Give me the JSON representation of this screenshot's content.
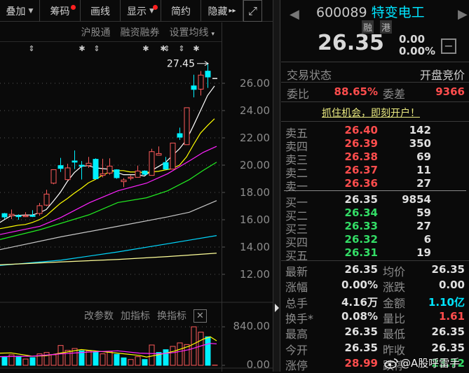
{
  "toolbar": {
    "items": [
      {
        "label": "叠加",
        "caret": true,
        "dot": false
      },
      {
        "label": "筹码",
        "caret": false,
        "dot": true
      },
      {
        "label": "画线",
        "caret": false,
        "dot": false
      },
      {
        "label": "显示",
        "caret": true,
        "dot": true
      },
      {
        "label": "简约",
        "caret": false,
        "dot": false
      },
      {
        "label": "隐藏",
        "caret": false,
        "dot": false,
        "suffix": "▸▸"
      }
    ],
    "expand_icon": "⤢"
  },
  "subheader": {
    "hgt": "沪股通",
    "margin": "融资融券",
    "ma_setting": "设置均线",
    "caret": "▾"
  },
  "markers": [
    "⇕",
    "✱",
    "⇕",
    "✱",
    "✱",
    "⇕",
    "⇕",
    "✱"
  ],
  "chart_data": {
    "type": "candlestick",
    "price_axis": {
      "ticks": [
        "26.00",
        "24.00",
        "22.00",
        "20.00",
        "18.00",
        "16.00",
        "14.00",
        "12.00"
      ],
      "range": [
        12,
        26
      ]
    },
    "max_label": "27.45",
    "candles": [
      [
        16.45,
        16.5,
        16.05,
        16.2
      ],
      [
        16.3,
        16.75,
        16.05,
        16.4
      ],
      [
        16.3,
        16.4,
        16.0,
        16.25
      ],
      [
        16.3,
        16.55,
        16.2,
        16.3
      ],
      [
        16.32,
        16.7,
        16.2,
        16.3
      ],
      [
        16.46,
        17.23,
        16.3,
        17.03
      ],
      [
        17.07,
        18.2,
        17.0,
        17.88
      ],
      [
        18.68,
        19.67,
        18.6,
        19.67
      ],
      [
        19.97,
        20.53,
        19.5,
        19.76
      ],
      [
        18.94,
        20.1,
        18.9,
        19.8
      ],
      [
        20.31,
        21.08,
        19.71,
        20.22
      ],
      [
        20.0,
        20.3,
        18.95,
        19.97
      ],
      [
        19.97,
        20.6,
        19.8,
        20.14
      ],
      [
        20.43,
        20.5,
        18.99,
        19.0
      ],
      [
        19.25,
        20.47,
        19.1,
        19.37
      ],
      [
        19.42,
        20.5,
        19.3,
        19.93
      ],
      [
        19.66,
        19.7,
        19.0,
        19.08
      ],
      [
        18.79,
        19.05,
        18.4,
        18.91
      ],
      [
        19.08,
        19.25,
        18.9,
        19.12
      ],
      [
        19.11,
        19.97,
        19.1,
        19.57
      ],
      [
        19.57,
        19.62,
        19.25,
        19.33
      ],
      [
        19.25,
        21.2,
        19.25,
        20.99
      ],
      [
        20.73,
        21.37,
        20.73,
        20.85
      ],
      [
        20.19,
        20.6,
        19.7,
        19.71
      ],
      [
        19.71,
        21.62,
        19.7,
        21.62
      ],
      [
        22.31,
        22.75,
        21.85,
        22.05
      ],
      [
        21.5,
        24.21,
        21.5,
        24.21
      ],
      [
        25.81,
        26.63,
        24.97,
        25.55
      ],
      [
        25.57,
        26.9,
        25.1,
        26.6
      ],
      [
        26.89,
        27.45,
        25.66,
        26.46
      ],
      [
        26.35,
        26.35,
        26.35,
        26.35
      ]
    ],
    "ma_lines": [
      {
        "name": "MA5",
        "color": "#ffffff",
        "points": [
          [
            0.4,
            15.8
          ],
          [
            1,
            16.0
          ],
          [
            2,
            16.3
          ],
          [
            3,
            16.32
          ],
          [
            4,
            16.35
          ],
          [
            5,
            16.35
          ],
          [
            6,
            16.5
          ],
          [
            7,
            16.75
          ],
          [
            8,
            17.35
          ],
          [
            9,
            18.0
          ],
          [
            10,
            18.8
          ],
          [
            11,
            19.45
          ],
          [
            12,
            19.9
          ],
          [
            13,
            19.97
          ],
          [
            14,
            19.8
          ],
          [
            15,
            19.75
          ],
          [
            16,
            19.7
          ],
          [
            17,
            19.5
          ],
          [
            18,
            19.3
          ],
          [
            19,
            19.3
          ],
          [
            20,
            19.3
          ],
          [
            21,
            19.2
          ],
          [
            22,
            19.6
          ],
          [
            23,
            19.9
          ],
          [
            24,
            20.2
          ],
          [
            25,
            20.7
          ],
          [
            26,
            21.2
          ],
          [
            27,
            21.85
          ],
          [
            28,
            22.9
          ],
          [
            29,
            24.0
          ],
          [
            30,
            25.1
          ],
          [
            31,
            25.8
          ]
        ]
      },
      {
        "name": "MA10",
        "color": "#ffff00",
        "points": [
          [
            0.4,
            15.35
          ],
          [
            1,
            15.4
          ],
          [
            2,
            15.5
          ],
          [
            3,
            15.6
          ],
          [
            4,
            15.65
          ],
          [
            5,
            15.8
          ],
          [
            6,
            16.0
          ],
          [
            7,
            16.3
          ],
          [
            8,
            16.75
          ],
          [
            9,
            17.2
          ],
          [
            10,
            17.55
          ],
          [
            11,
            17.95
          ],
          [
            12,
            18.3
          ],
          [
            13,
            18.7
          ],
          [
            14,
            18.95
          ],
          [
            15,
            19.25
          ],
          [
            16,
            19.5
          ],
          [
            17,
            19.6
          ],
          [
            18,
            19.6
          ],
          [
            19,
            19.5
          ],
          [
            20,
            19.5
          ],
          [
            21,
            19.45
          ],
          [
            22,
            19.5
          ],
          [
            23,
            19.55
          ],
          [
            24,
            19.65
          ],
          [
            25,
            19.75
          ],
          [
            26,
            20.0
          ],
          [
            27,
            20.6
          ],
          [
            28,
            21.5
          ],
          [
            29,
            22.35
          ],
          [
            30,
            22.9
          ],
          [
            31,
            23.4
          ]
        ]
      },
      {
        "name": "MA20",
        "color": "#ff22ff",
        "points": [
          [
            0.4,
            14.92
          ],
          [
            6.1,
            15.52
          ],
          [
            9.1,
            16.17
          ],
          [
            13.2,
            17.26
          ],
          [
            17.2,
            18.12
          ],
          [
            21.3,
            18.68
          ],
          [
            24.3,
            19.37
          ],
          [
            27.4,
            20.31
          ],
          [
            29.4,
            20.94
          ],
          [
            31.3,
            21.38
          ]
        ]
      },
      {
        "name": "MA30",
        "color": "#22ee22",
        "points": [
          [
            0.4,
            14.55
          ],
          [
            6.1,
            15.27
          ],
          [
            13.2,
            16.38
          ],
          [
            17.2,
            17.26
          ],
          [
            21.3,
            17.61
          ],
          [
            24.3,
            18.12
          ],
          [
            27.4,
            18.94
          ],
          [
            29.4,
            19.62
          ],
          [
            31.3,
            20.22
          ]
        ]
      },
      {
        "name": "MA60",
        "color": "#c8c8c8",
        "points": [
          [
            0.4,
            13.81
          ],
          [
            9.1,
            14.75
          ],
          [
            17.2,
            15.52
          ],
          [
            24.3,
            16.21
          ],
          [
            27.4,
            16.55
          ],
          [
            31.3,
            17.4
          ]
        ]
      },
      {
        "name": "MA120",
        "color": "#00d8ff",
        "points": [
          [
            0.4,
            12.65
          ],
          [
            9.1,
            13.04
          ],
          [
            17.2,
            13.64
          ],
          [
            24.3,
            14.24
          ],
          [
            31.3,
            14.84
          ]
        ]
      },
      {
        "name": "MA250",
        "color": "#ffff99",
        "points": [
          [
            0.4,
            12.7
          ],
          [
            9.1,
            12.91
          ],
          [
            17.2,
            13.09
          ],
          [
            24.3,
            13.3
          ],
          [
            31.3,
            13.55
          ]
        ]
      }
    ],
    "volume": {
      "ticks": [
        "840.00",
        "0.00"
      ],
      "range": [
        0,
        840
      ],
      "bars": [
        [
          178,
          "down"
        ],
        [
          229,
          "up"
        ],
        [
          199,
          "down"
        ],
        [
          137,
          "up"
        ],
        [
          168,
          "down"
        ],
        [
          250,
          "up"
        ],
        [
          280,
          "up"
        ],
        [
          229,
          "up"
        ],
        [
          433,
          "up"
        ],
        [
          326,
          "up"
        ],
        [
          367,
          "up"
        ],
        [
          316,
          "down"
        ],
        [
          316,
          "up"
        ],
        [
          290,
          "down"
        ],
        [
          250,
          "up"
        ],
        [
          301,
          "up"
        ],
        [
          240,
          "down"
        ],
        [
          163,
          "down"
        ],
        [
          127,
          "up"
        ],
        [
          189,
          "up"
        ],
        [
          127,
          "down"
        ],
        [
          443,
          "up"
        ],
        [
          280,
          "down"
        ],
        [
          341,
          "down"
        ],
        [
          413,
          "up"
        ],
        [
          489,
          "up"
        ],
        [
          453,
          "up"
        ],
        [
          840,
          "up"
        ],
        [
          723,
          "up"
        ],
        [
          622,
          "down"
        ],
        [
          4,
          "up"
        ]
      ],
      "ma_lines": [
        {
          "name": "VMA5",
          "color": "#ffff00",
          "points": [
            [
              0.4,
              265
            ],
            [
              2,
              270
            ],
            [
              5,
              199
            ],
            [
              7,
              210
            ],
            [
              9,
              265
            ],
            [
              12,
              343
            ],
            [
              14.2,
              310
            ],
            [
              17.2,
              265
            ],
            [
              20.3,
              215
            ],
            [
              21.3,
              180
            ],
            [
              23.3,
              240
            ],
            [
              25.3,
              310
            ],
            [
              27.4,
              418
            ],
            [
              29.4,
              572
            ],
            [
              30.4,
              622
            ],
            [
              31.3,
              535
            ]
          ]
        },
        {
          "name": "VMA10",
          "color": "#ff22ff",
          "points": [
            [
              0.4,
              189
            ],
            [
              5,
              199
            ],
            [
              9.1,
              250
            ],
            [
              13.2,
              290
            ],
            [
              17.2,
              316
            ],
            [
              20.3,
              265
            ],
            [
              23.3,
              250
            ],
            [
              25.3,
              280
            ],
            [
              27.4,
              343
            ],
            [
              29.4,
              439
            ],
            [
              30.4,
              478
            ],
            [
              31.3,
              468
            ]
          ]
        }
      ]
    },
    "colors": {
      "up": "#ff5a5a",
      "down": "#00f0ff"
    }
  },
  "volume_header": {
    "edit_params": "改参数",
    "add_indicator": "加指标",
    "switch_indicator": "换指标",
    "close": "✕"
  },
  "quote": {
    "code": "600089",
    "name": "特变电工",
    "badges": [
      "融",
      "港"
    ],
    "price": "26.35",
    "change": "0.00",
    "change_pct": "0.00%",
    "minus": "−",
    "prev_arrow": "◀",
    "next_arrow": "▶"
  },
  "status": {
    "label": "交易状态",
    "value": "开盘竞价"
  },
  "ratio": {
    "label": "委比",
    "value": "88.65%",
    "diff_label": "委差",
    "diff_value": "9366"
  },
  "promo": "抓住机会，即刻开户！",
  "asks": [
    {
      "label": "卖五",
      "price": "26.40",
      "vol": "142"
    },
    {
      "label": "卖四",
      "price": "26.39",
      "vol": "350"
    },
    {
      "label": "卖三",
      "price": "26.38",
      "vol": "69"
    },
    {
      "label": "卖二",
      "price": "26.37",
      "vol": "11"
    },
    {
      "label": "卖一",
      "price": "26.36",
      "vol": "27"
    }
  ],
  "bids": [
    {
      "label": "买一",
      "price": "26.35",
      "vol": "9854",
      "color": "white"
    },
    {
      "label": "买二",
      "price": "26.34",
      "vol": "59",
      "color": "green"
    },
    {
      "label": "买三",
      "price": "26.33",
      "vol": "27",
      "color": "green"
    },
    {
      "label": "买四",
      "price": "26.32",
      "vol": "6",
      "color": "green"
    },
    {
      "label": "买五",
      "price": "26.31",
      "vol": "19",
      "color": "green"
    }
  ],
  "stats": [
    {
      "l1": "最新",
      "v1": "26.35",
      "c1": "white",
      "l2": "均价",
      "v2": "26.35",
      "c2": "white"
    },
    {
      "l1": "涨幅",
      "v1": "0.00%",
      "c1": "white",
      "l2": "涨跌",
      "v2": "0.00",
      "c2": "white"
    },
    {
      "l1": "总手",
      "v1": "4.16万",
      "c1": "white",
      "l2": "金额",
      "v2": "1.10亿",
      "c2": "cyan"
    },
    {
      "l1": "换手*",
      "v1": "0.08%",
      "c1": "white",
      "l2": "量比",
      "v2": "1.61",
      "c2": "red"
    },
    {
      "l1": "最高",
      "v1": "26.35",
      "c1": "white",
      "l2": "最低",
      "v2": "26.35",
      "c2": "white"
    },
    {
      "l1": "今开",
      "v1": "26.35",
      "c1": "white",
      "l2": "昨收",
      "v2": "26.35",
      "c2": "white"
    },
    {
      "l1": "涨停",
      "v1": "28.99",
      "c1": "red",
      "l2": "跌停",
      "v2": "23.72",
      "c2": "green"
    }
  ],
  "watermark": "@A股呼雷手"
}
